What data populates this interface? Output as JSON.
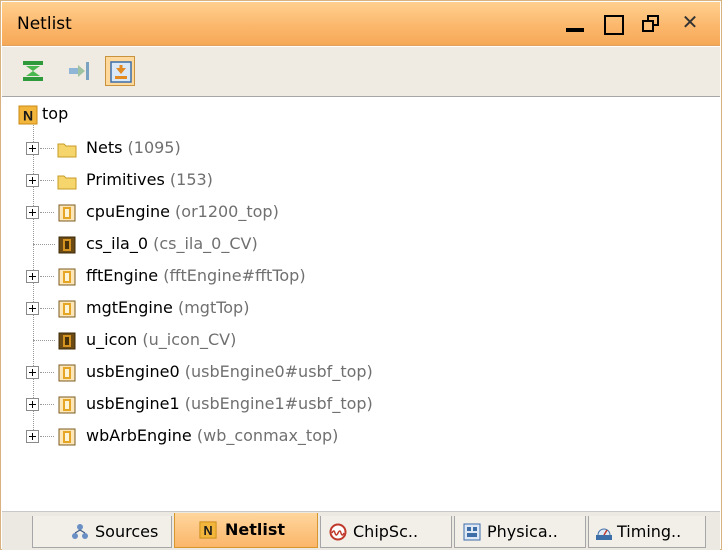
{
  "window": {
    "title": "Netlist",
    "controls": {
      "close_glyph": "✕"
    }
  },
  "toolbar": {
    "buttons": [
      {
        "icon": "collapse-all-icon"
      },
      {
        "icon": "show-hierarchy-icon"
      },
      {
        "icon": "import-netlist-icon",
        "active": true
      }
    ]
  },
  "tree": {
    "root": {
      "label": "top",
      "icon": "netlist-n-icon"
    },
    "children": [
      {
        "name": "Nets",
        "detail": "(1095)",
        "icon": "folder-icon",
        "expandable": true
      },
      {
        "name": "Primitives",
        "detail": "(153)",
        "icon": "folder-icon",
        "expandable": true
      },
      {
        "name": "cpuEngine",
        "detail": "(or1200_top)",
        "icon": "module-icon",
        "expandable": true
      },
      {
        "name": "cs_ila_0",
        "detail": "(cs_ila_0_CV)",
        "icon": "black-box-icon",
        "expandable": false
      },
      {
        "name": "fftEngine",
        "detail": "(fftEngine#fftTop)",
        "icon": "module-icon",
        "expandable": true
      },
      {
        "name": "mgtEngine",
        "detail": "(mgtTop)",
        "icon": "module-icon",
        "expandable": true
      },
      {
        "name": "u_icon",
        "detail": "(u_icon_CV)",
        "icon": "black-box-icon",
        "expandable": false
      },
      {
        "name": "usbEngine0",
        "detail": "(usbEngine0#usbf_top)",
        "icon": "module-icon",
        "expandable": true
      },
      {
        "name": "usbEngine1",
        "detail": "(usbEngine1#usbf_top)",
        "icon": "module-icon",
        "expandable": true
      },
      {
        "name": "wbArbEngine",
        "detail": "(wb_conmax_top)",
        "icon": "module-icon",
        "expandable": true
      }
    ]
  },
  "tabs": [
    {
      "label": "Sources",
      "icon": "sources-icon",
      "active": false
    },
    {
      "label": "Netlist",
      "icon": "netlist-n-icon",
      "active": true
    },
    {
      "label": "ChipSc..",
      "icon": "chipscope-icon",
      "active": false
    },
    {
      "label": "Physica..",
      "icon": "physical-icon",
      "active": false
    },
    {
      "label": "Timing..",
      "icon": "timing-icon",
      "active": false
    }
  ],
  "colors": {
    "accent": "#fbb66a",
    "folder": "#f6d56c",
    "module": "#e7a526",
    "detail_text": "#707070"
  }
}
